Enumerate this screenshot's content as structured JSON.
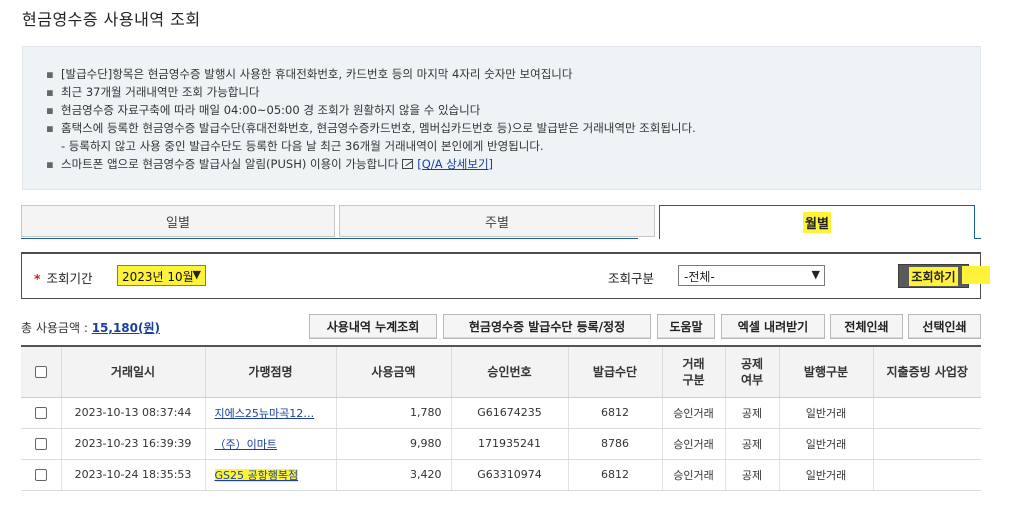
{
  "page": {
    "title": "현금영수증 사용내역 조회"
  },
  "notice": {
    "lines": [
      "[발급수단]항목은 현금영수증 발행시 사용한 휴대전화번호, 카드번호 등의 마지막 4자리 숫자만 보여집니다",
      "최근 37개월 거래내역만 조회 가능합니다",
      "현금영수증 자료구축에 따라 매일 04:00~05:00 경 조회가 원활하지 않을 수 있습니다",
      "홈택스에 등록한 현금영수증 발급수단(휴대전화번호, 현금영수증카드번호, 멤버십카드번호 등)으로 발급받은 거래내역만 조회됩니다.",
      "- 등록하지 않고 사용 중인 발급수단도 등록한 다음 날 최근 36개월 거래내역이 본인에게 반영됩니다.",
      "스마트폰 앱으로 현금영수증 발급사실 알림(PUSH) 이용이 가능합니다"
    ],
    "qa_link": "[Q/A 상세보기]"
  },
  "tabs": [
    {
      "label": "일별"
    },
    {
      "label": "주별"
    },
    {
      "label": "월별"
    }
  ],
  "search": {
    "period_label": "조회기간",
    "required_mark": "*",
    "period_value": "2023년 10월",
    "type_label": "조회구분",
    "type_value": "-전체-",
    "search_button": "조회하기"
  },
  "summary": {
    "total_label": "총 사용금액 :",
    "total_amount": "15,180(원)"
  },
  "actions": [
    "사용내역 누계조회",
    "현금영수증 발급수단 등록/정정",
    "도움말",
    "엑셀 내려받기",
    "전체인쇄",
    "선택인쇄"
  ],
  "table": {
    "headers": {
      "date": "거래일시",
      "merchant": "가맹점명",
      "amount": "사용금액",
      "approval": "승인번호",
      "means": "발급수단",
      "trade_type_1": "거래",
      "trade_type_2": "구분",
      "deduct_1": "공제",
      "deduct_2": "여부",
      "issue_type": "발행구분",
      "business": "지출증빙 사업장"
    },
    "rows": [
      {
        "date": "2023-10-13 08:37:44",
        "merchant": "지에스25뉴마곡12…",
        "amount": "1,780",
        "approval": "G61674235",
        "means": "6812",
        "trade_type": "승인거래",
        "deduct": "공제",
        "issue_type": "일반거래",
        "business": ""
      },
      {
        "date": "2023-10-23 16:39:39",
        "merchant": "（주）이마트",
        "amount": "9,980",
        "approval": "171935241",
        "means": "8786",
        "trade_type": "승인거래",
        "deduct": "공제",
        "issue_type": "일반거래",
        "business": ""
      },
      {
        "date": "2023-10-24 18:35:53",
        "merchant": "GS25 공항행복점",
        "amount": "3,420",
        "approval": "G63310974",
        "means": "6812",
        "trade_type": "승인거래",
        "deduct": "공제",
        "issue_type": "일반거래",
        "business": ""
      }
    ]
  },
  "colors": {
    "highlight": "#fff23a",
    "link": "#1a3fa0",
    "active_tab_border": "#1f5f8f",
    "search_button": "#5a5a5a"
  }
}
